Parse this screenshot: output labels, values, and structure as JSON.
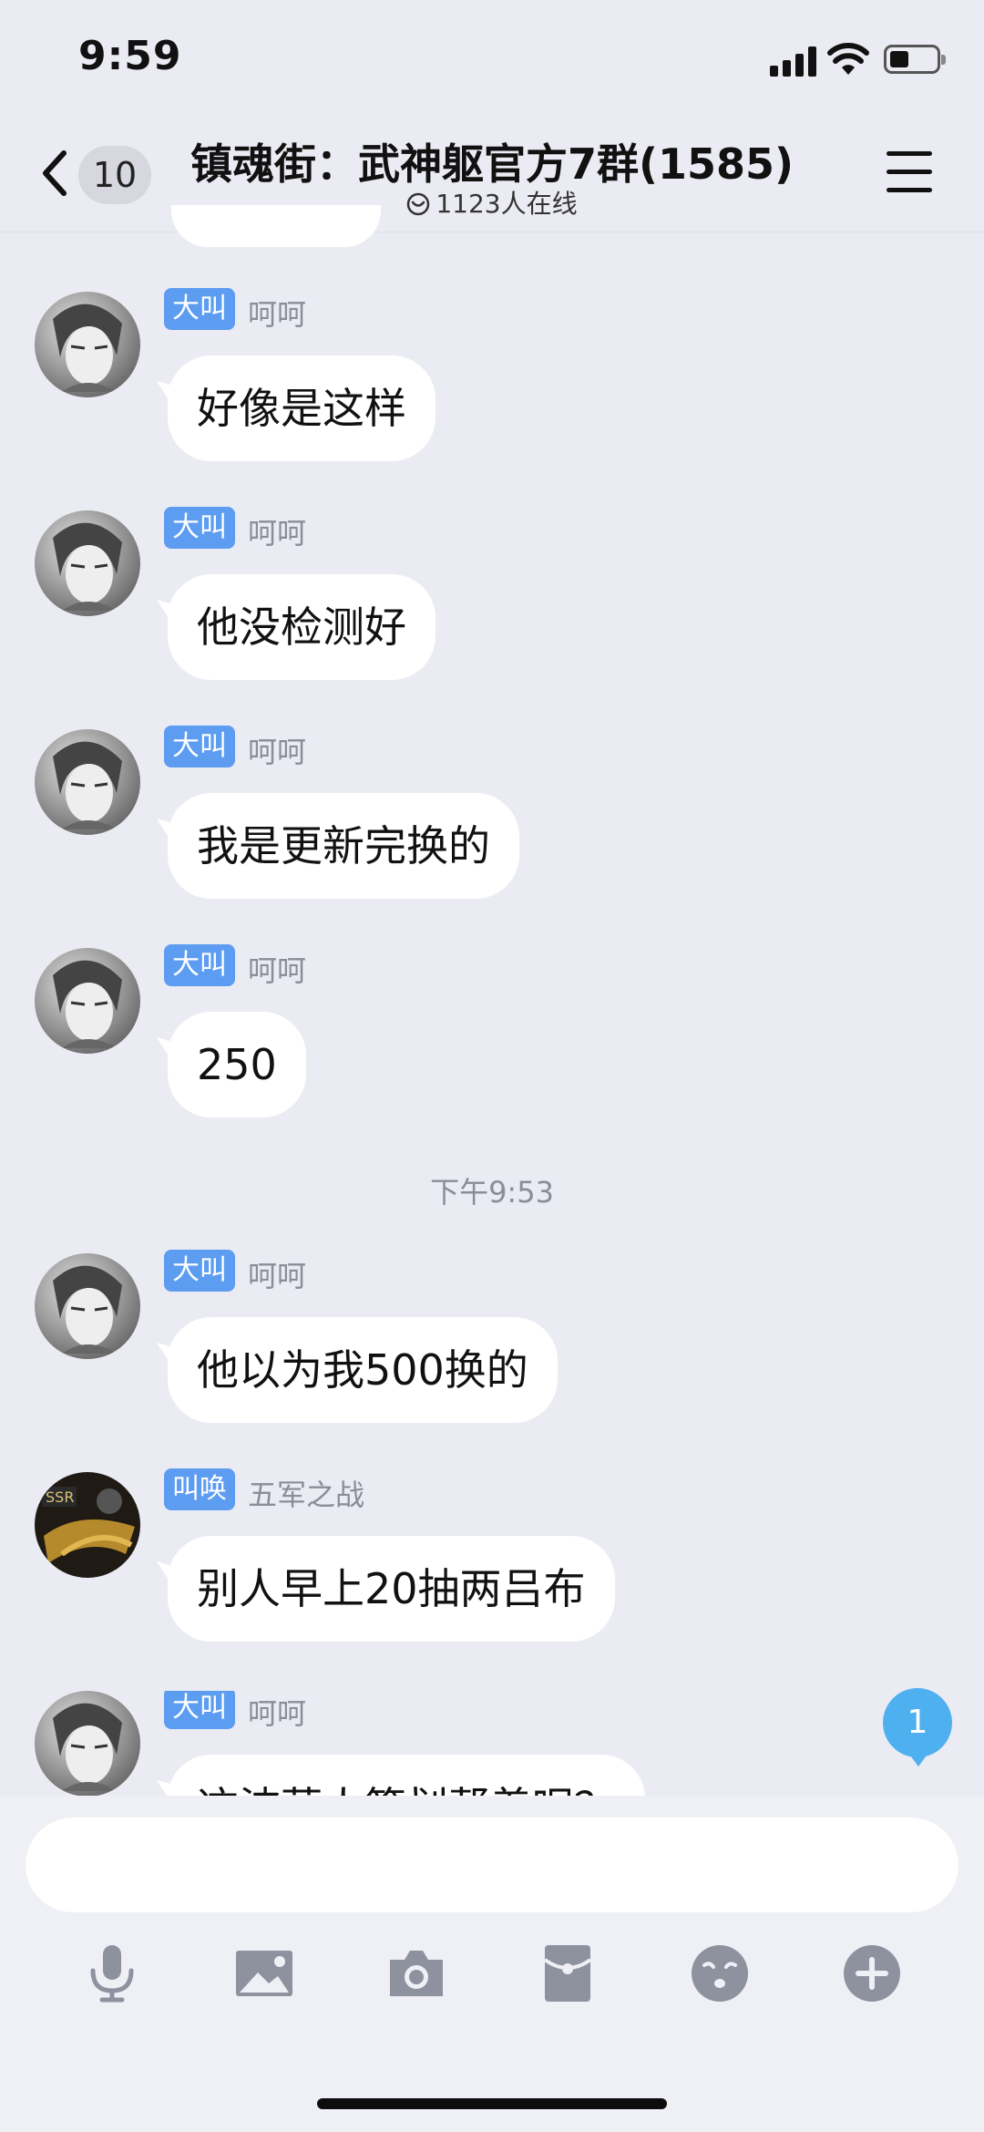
{
  "status": {
    "time": "9:59"
  },
  "header": {
    "unread_count": "10",
    "title": "镇魂街：武神躯官方7群(1585)",
    "online": "1123人在线"
  },
  "messages": [
    {
      "tag": "大叫",
      "sender": "呵呵",
      "text": "好像是这样"
    },
    {
      "tag": "大叫",
      "sender": "呵呵",
      "text": "他没检测好"
    },
    {
      "tag": "大叫",
      "sender": "呵呵",
      "text": "我是更新完换的"
    },
    {
      "tag": "大叫",
      "sender": "呵呵",
      "text": "250"
    },
    {
      "tag": "大叫",
      "sender": "呵呵",
      "text": "他以为我500换的"
    },
    {
      "tag": "叫唤",
      "sender": "五军之战",
      "text": "别人早上20抽两吕布"
    },
    {
      "tag": "大叫",
      "sender": "呵呵",
      "text": "这波蓝人策划帮着呢？"
    }
  ],
  "timestamp": "下午9:53",
  "new_message_badge": "1",
  "input": {
    "value": ""
  },
  "toolbar": [
    "microphone-icon",
    "image-icon",
    "camera-icon",
    "red-packet-icon",
    "emoji-icon",
    "plus-icon"
  ],
  "colors": {
    "background": "#ebecf3",
    "tag_blue": "#5c9cf1",
    "badge_blue": "#4fb0f0",
    "icon_gray": "#8e929f"
  }
}
